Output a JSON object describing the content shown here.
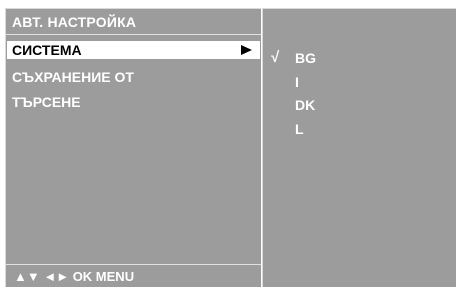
{
  "menu": {
    "title": "АВТ. НАСТРОЙКА",
    "items": [
      {
        "label": "СИСТЕМА",
        "selected": true
      },
      {
        "label": "СЪХРАНЕНИЕ ОТ",
        "selected": false
      },
      {
        "label": "ТЪРСЕНЕ",
        "selected": false
      }
    ],
    "footer": "▲▼  ◄►  OK  MENU"
  },
  "submenu": {
    "check_mark": "√",
    "options": [
      {
        "label": "BG",
        "checked": true
      },
      {
        "label": "I",
        "checked": false
      },
      {
        "label": "DK",
        "checked": false
      },
      {
        "label": "L",
        "checked": false
      }
    ]
  },
  "colors": {
    "panel": "#9c9c9c",
    "text": "#ffffff",
    "highlight": "#ffffff",
    "highlight_text": "#000000"
  }
}
